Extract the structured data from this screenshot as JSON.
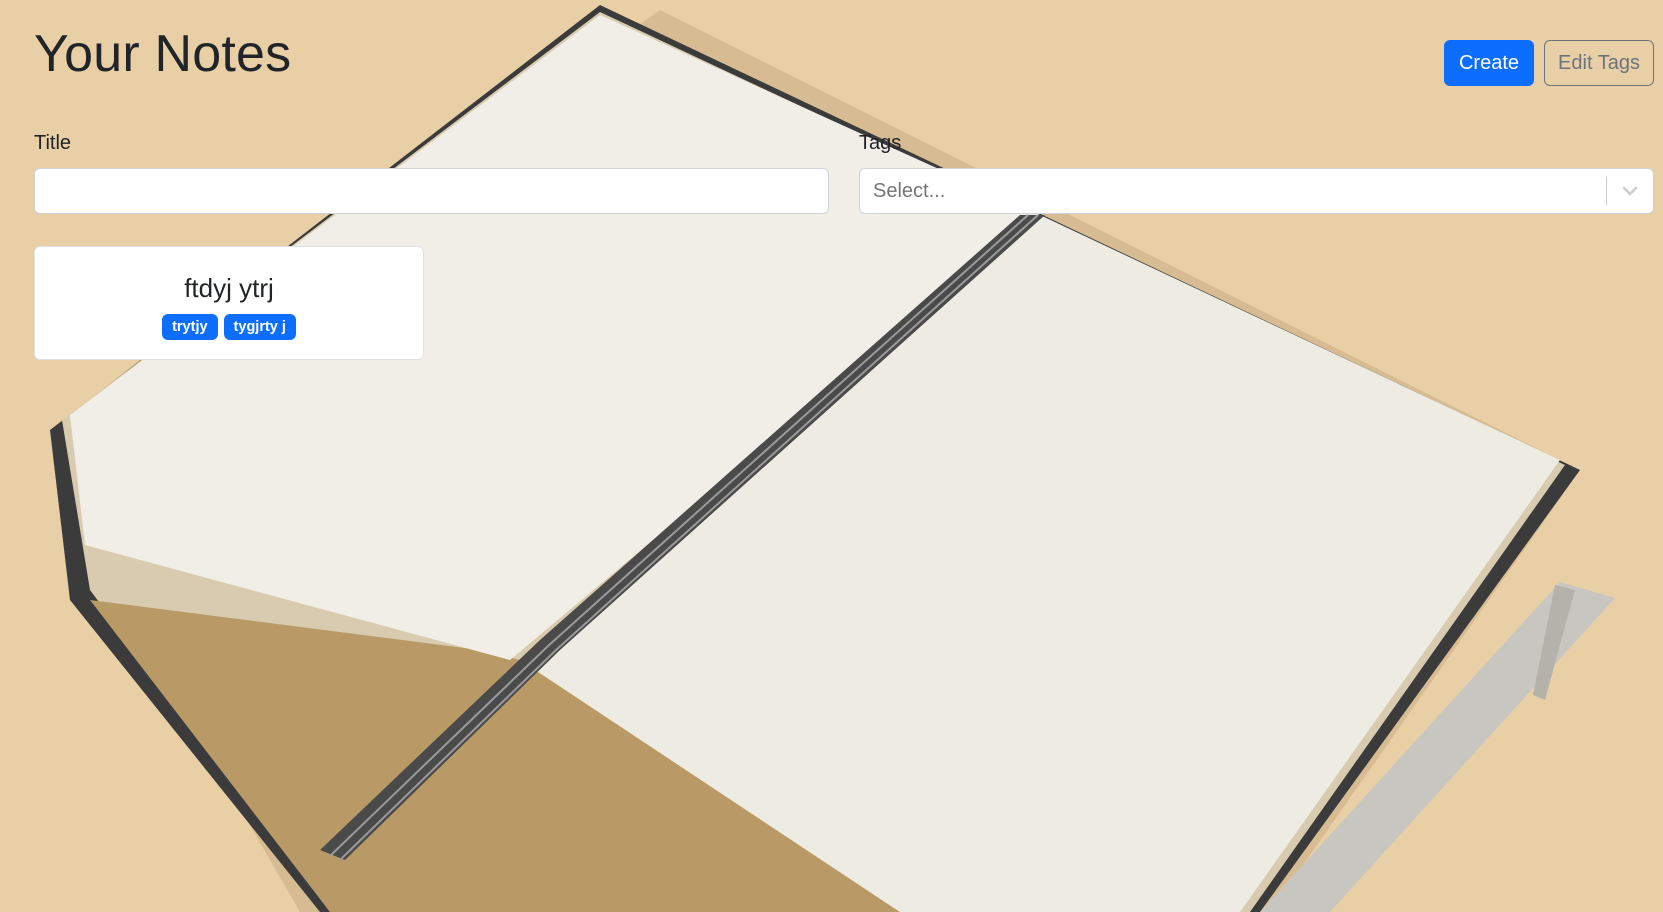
{
  "page": {
    "title": "Your Notes"
  },
  "actions": {
    "create_label": "Create",
    "edit_tags_label": "Edit Tags"
  },
  "filters": {
    "title_label": "Title",
    "title_value": "",
    "tags_label": "Tags",
    "tags_placeholder": "Select..."
  },
  "notes": [
    {
      "title": "ftdyj ytrj",
      "tags": [
        "trytjy",
        "tygjrty j"
      ]
    }
  ],
  "colors": {
    "primary": "#0d6efd",
    "secondary": "#6c757d",
    "background": "#e9cfa6"
  },
  "icons": {
    "dropdown": "chevron-down-icon"
  }
}
